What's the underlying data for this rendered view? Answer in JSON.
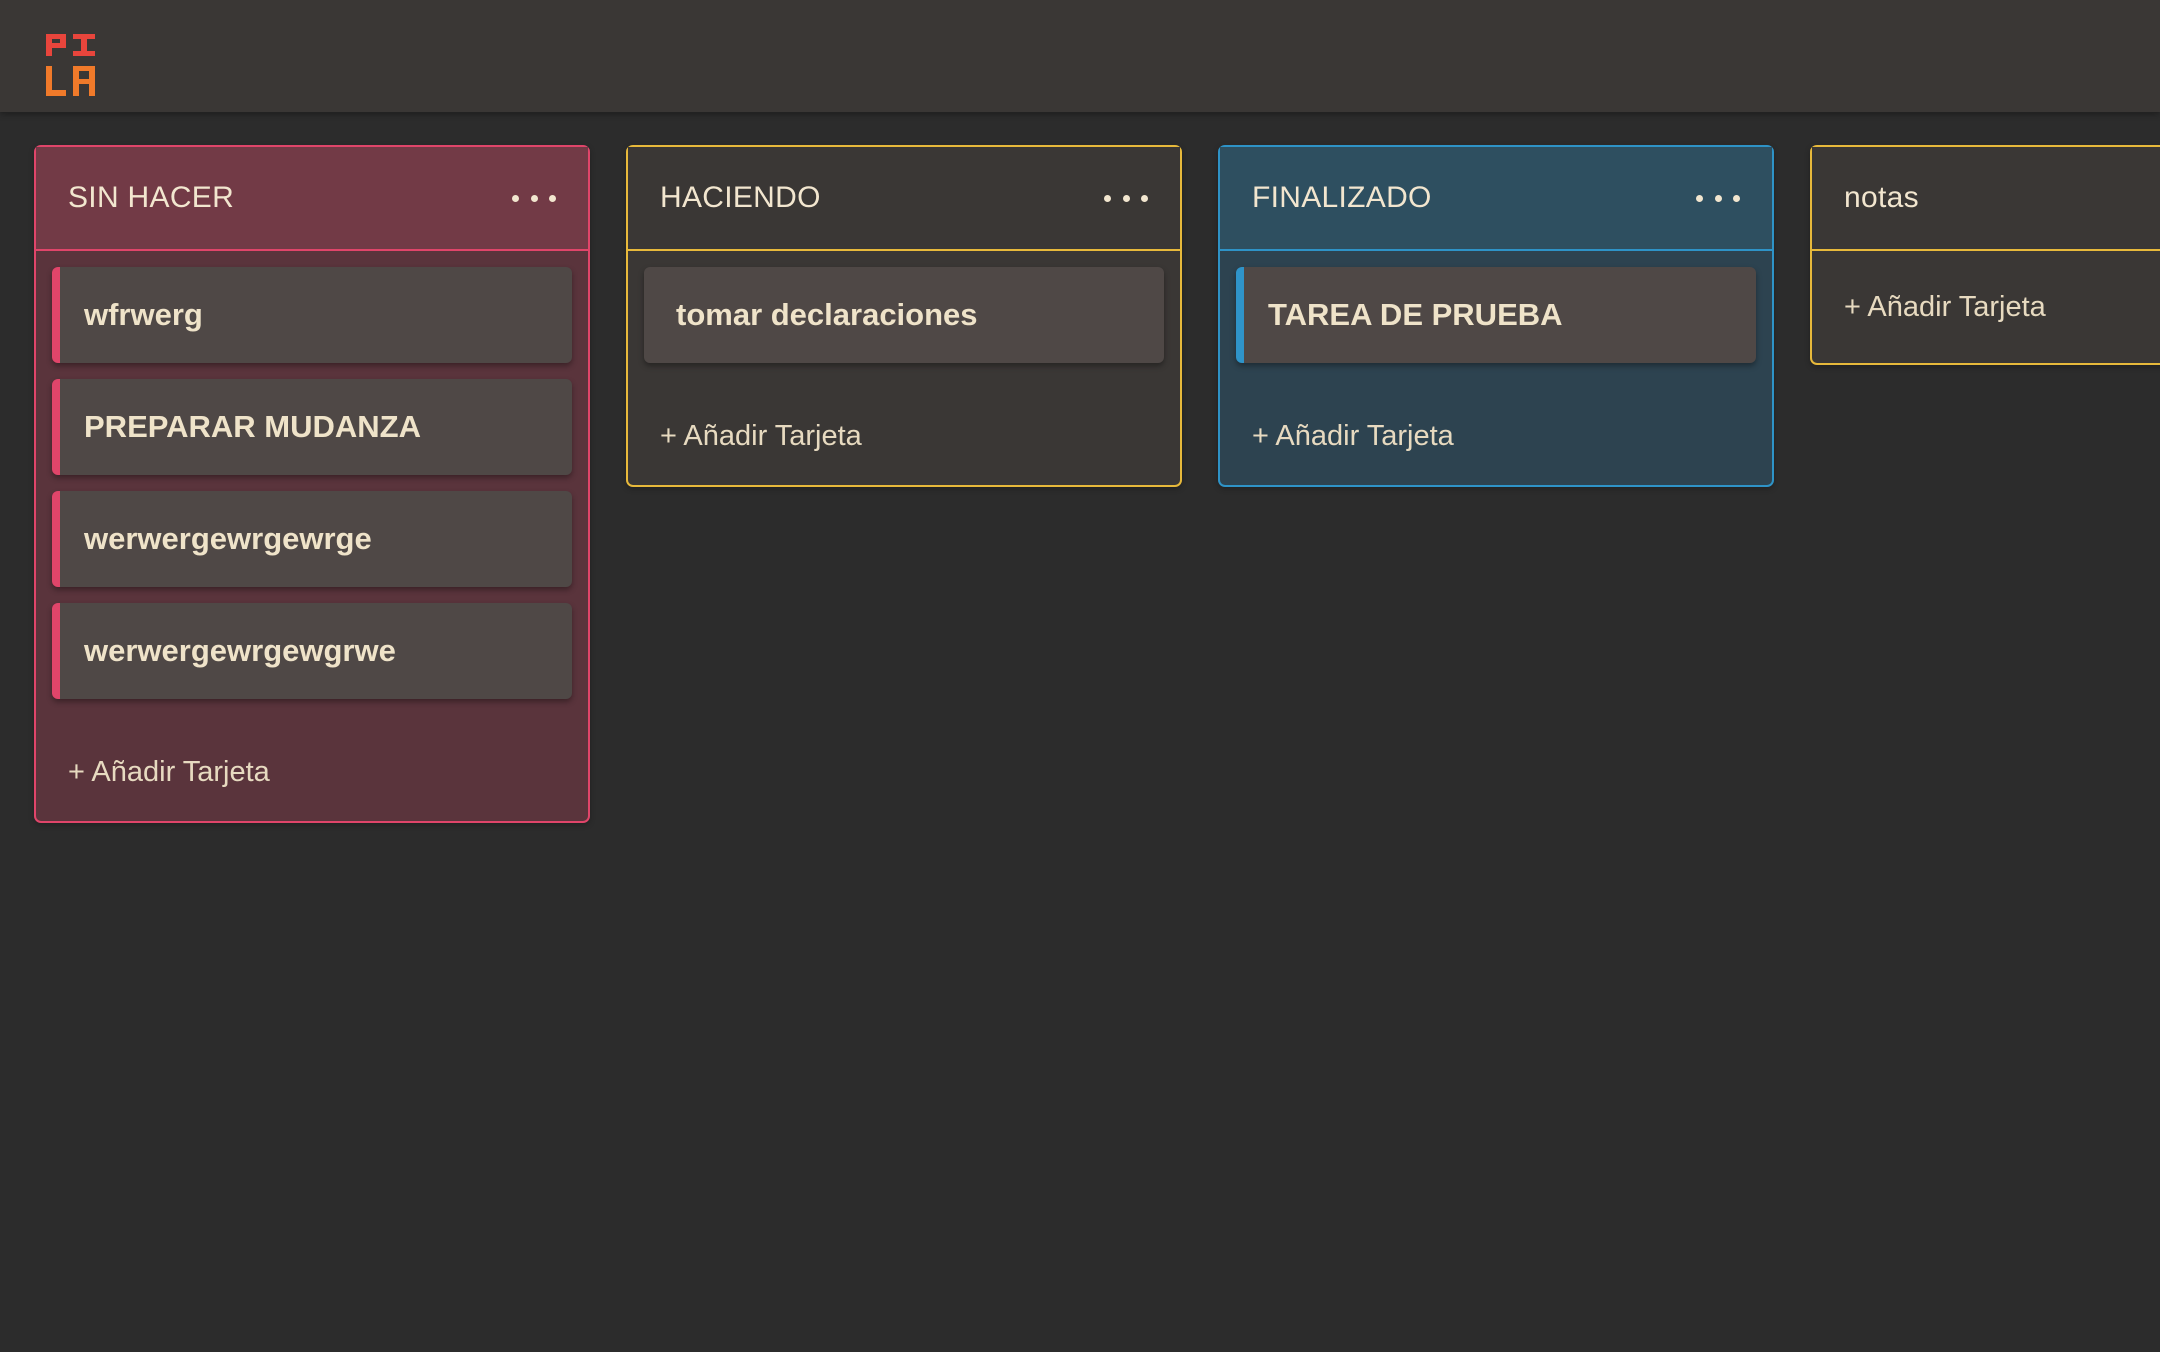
{
  "app": {
    "logo_text": "PILA",
    "logo_colors": [
      "#e8453c",
      "#f07a2a"
    ]
  },
  "columns": [
    {
      "title": "SIN HACER",
      "accent": "#e0456a",
      "cards": [
        "wfrwerg",
        "PREPARAR MUDANZA",
        "werwergewrgewrge",
        "werwergewrgewgrwe"
      ],
      "add_label": "+ Añadir Tarjeta",
      "has_menu": true
    },
    {
      "title": "HACIENDO",
      "accent": "#e7b93b",
      "cards": [
        "tomar declaraciones"
      ],
      "add_label": "+ Añadir Tarjeta",
      "has_menu": true
    },
    {
      "title": "FINALIZADO",
      "accent": "#2e93c7",
      "cards": [
        "TAREA DE PRUEBA"
      ],
      "add_label": "+ Añadir Tarjeta",
      "has_menu": true
    },
    {
      "title": "notas",
      "accent": "#e7b93b",
      "cards": [],
      "add_label": "+ Añadir Tarjeta",
      "has_menu": false
    }
  ]
}
